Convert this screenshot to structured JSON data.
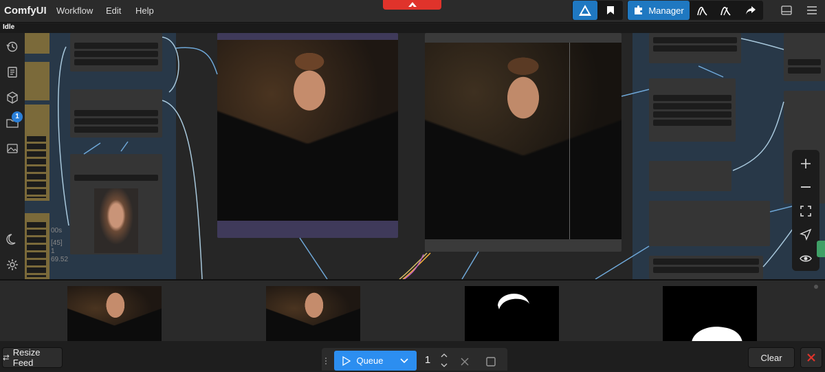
{
  "app": {
    "title": "ComfyUI"
  },
  "menu": [
    {
      "label": "Workflow"
    },
    {
      "label": "Edit"
    },
    {
      "label": "Help"
    }
  ],
  "toolbar": {
    "manager_label": "Manager"
  },
  "status": {
    "text": "Idle"
  },
  "sidebar": {
    "queue_badge": "1"
  },
  "canvas": {
    "partial_labels": [
      "00s",
      "[45]",
      "1",
      "69.52"
    ]
  },
  "queue": {
    "queue_label": "Queue",
    "batch_count": "1"
  },
  "feed": {
    "resize_label": "Resize Feed",
    "clear_label": "Clear"
  },
  "colors": {
    "accent": "#1f78c1",
    "danger": "#e0332b",
    "node_bg": "#353535",
    "canvas_bg": "#283848"
  },
  "icons": [
    "history-icon",
    "document-icon",
    "cube-icon",
    "folder-images-icon",
    "image-icon",
    "moon-icon",
    "gear-icon",
    "bookmark-icon",
    "puzzle-icon",
    "share-icon",
    "plus-icon",
    "minus-icon",
    "fit-view-icon",
    "navigate-icon",
    "eye-icon"
  ]
}
